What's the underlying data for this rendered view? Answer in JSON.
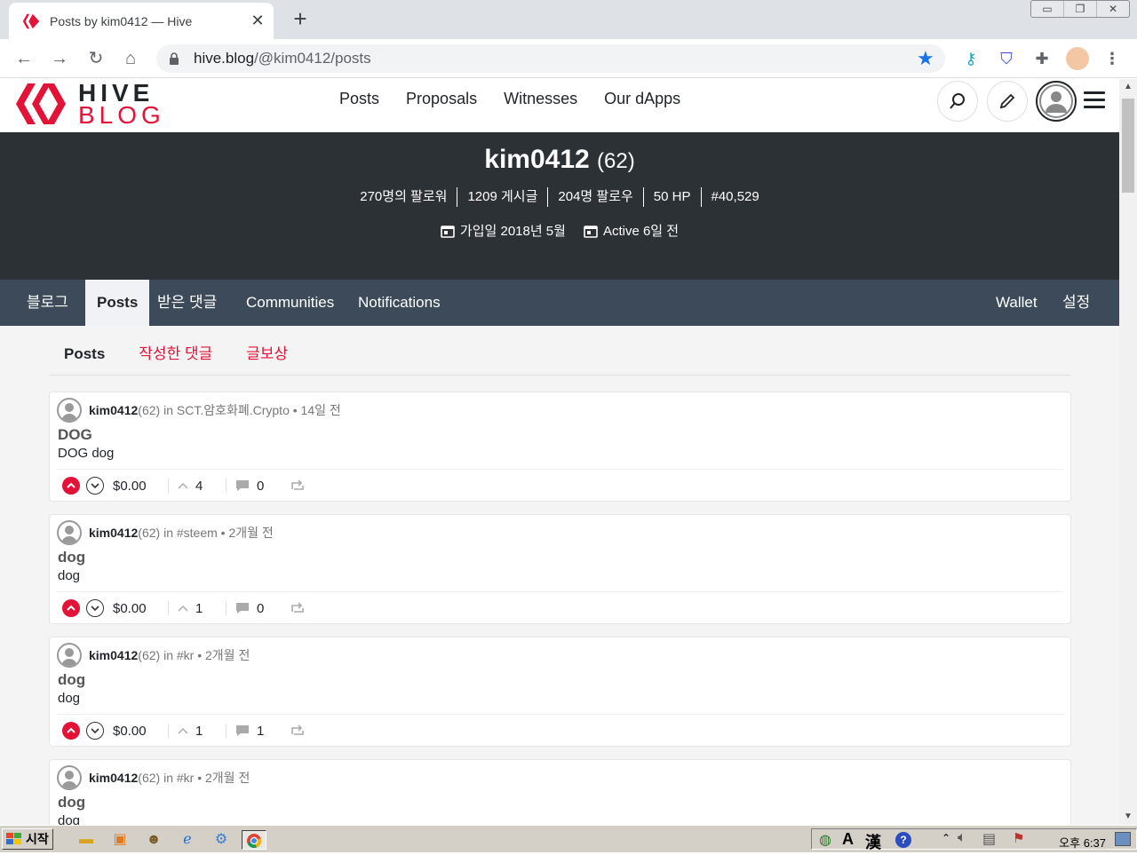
{
  "browser": {
    "tab_title": "Posts by kim0412 — Hive",
    "url_domain": "hive.blog",
    "url_path": "/@kim0412/posts"
  },
  "site": {
    "logo_line1": "HIVE",
    "logo_line2": "BLOG",
    "nav": [
      "Posts",
      "Proposals",
      "Witnesses",
      "Our dApps"
    ]
  },
  "profile": {
    "name": "kim0412",
    "reputation": "(62)",
    "stats": [
      "270명의 팔로워",
      "1209 게시글",
      "204명 팔로우",
      "50 HP",
      "#40,529"
    ],
    "joined": "가입일 2018년 5월",
    "active": "Active 6일 전"
  },
  "profile_tabs": {
    "left": [
      "블로그",
      "Posts",
      "받은 댓글",
      "Communities",
      "Notifications"
    ],
    "right": [
      "Wallet",
      "설정"
    ],
    "active": "Posts"
  },
  "subtabs": [
    "Posts",
    "작성한 댓글",
    "글보상"
  ],
  "posts": [
    {
      "author": "kim0412",
      "rep": "(62)",
      "in": "in",
      "community": "SCT.암호화폐.Crypto",
      "time": "14일 전",
      "title": "DOG",
      "body": "DOG dog",
      "payout": "$0.00",
      "votes": "4",
      "comments": "0"
    },
    {
      "author": "kim0412",
      "rep": "(62)",
      "in": "in",
      "community": "#steem",
      "time": "2개월 전",
      "title": "dog",
      "body": "dog",
      "payout": "$0.00",
      "votes": "1",
      "comments": "0"
    },
    {
      "author": "kim0412",
      "rep": "(62)",
      "in": "in",
      "community": "#kr",
      "time": "2개월 전",
      "title": "dog",
      "body": "dog",
      "payout": "$0.00",
      "votes": "1",
      "comments": "1"
    },
    {
      "author": "kim0412",
      "rep": "(62)",
      "in": "in",
      "community": "#kr",
      "time": "2개월 전",
      "title": "dog",
      "body": "dog",
      "payout": "",
      "votes": "",
      "comments": ""
    }
  ],
  "taskbar": {
    "start": "시작",
    "ime_a": "A",
    "ime_han": "漢",
    "clock": "오후 6:37"
  },
  "colors": {
    "accent": "#e31337",
    "banner": "#2c3136",
    "tabs": "#3c4a59"
  }
}
